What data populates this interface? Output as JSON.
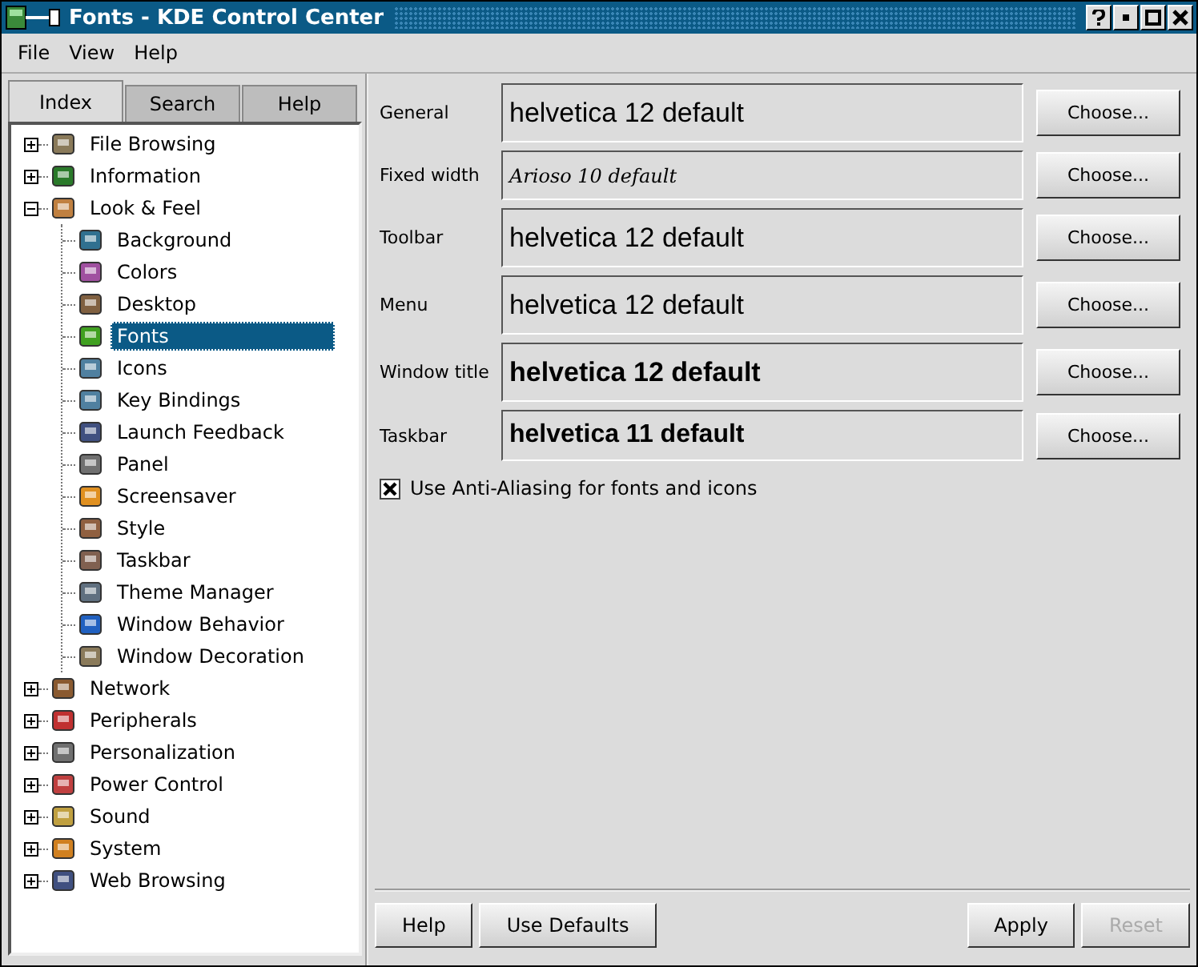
{
  "window": {
    "title": "Fonts - KDE Control Center"
  },
  "menu": [
    "File",
    "View",
    "Help"
  ],
  "tabs": [
    {
      "label": "Index",
      "selected": true
    },
    {
      "label": "Search",
      "selected": false
    },
    {
      "label": "Help",
      "selected": false
    }
  ],
  "tree": [
    {
      "label": "File Browsing",
      "expanded": false,
      "selected": false
    },
    {
      "label": "Information",
      "expanded": false,
      "selected": false
    },
    {
      "label": "Look & Feel",
      "expanded": true,
      "selected": false,
      "children": [
        {
          "label": "Background",
          "selected": false
        },
        {
          "label": "Colors",
          "selected": false
        },
        {
          "label": "Desktop",
          "selected": false
        },
        {
          "label": "Fonts",
          "selected": true
        },
        {
          "label": "Icons",
          "selected": false
        },
        {
          "label": "Key Bindings",
          "selected": false
        },
        {
          "label": "Launch Feedback",
          "selected": false
        },
        {
          "label": "Panel",
          "selected": false
        },
        {
          "label": "Screensaver",
          "selected": false
        },
        {
          "label": "Style",
          "selected": false
        },
        {
          "label": "Taskbar",
          "selected": false
        },
        {
          "label": "Theme Manager",
          "selected": false
        },
        {
          "label": "Window Behavior",
          "selected": false
        },
        {
          "label": "Window Decoration",
          "selected": false
        }
      ]
    },
    {
      "label": "Network",
      "expanded": false,
      "selected": false
    },
    {
      "label": "Peripherals",
      "expanded": false,
      "selected": false
    },
    {
      "label": "Personalization",
      "expanded": false,
      "selected": false
    },
    {
      "label": "Power Control",
      "expanded": false,
      "selected": false
    },
    {
      "label": "Sound",
      "expanded": false,
      "selected": false
    },
    {
      "label": "System",
      "expanded": false,
      "selected": false
    },
    {
      "label": "Web Browsing",
      "expanded": false,
      "selected": false
    }
  ],
  "fonts": [
    {
      "label": "General",
      "preview": "helvetica 12 default",
      "kind": "large",
      "button": "Choose..."
    },
    {
      "label": "Fixed width",
      "preview": "Arioso 10 default",
      "kind": "script",
      "button": "Choose..."
    },
    {
      "label": "Toolbar",
      "preview": "helvetica 12 default",
      "kind": "large",
      "button": "Choose..."
    },
    {
      "label": "Menu",
      "preview": "helvetica 12 default",
      "kind": "large",
      "button": "Choose..."
    },
    {
      "label": "Window title",
      "preview": "helvetica 12 default",
      "kind": "bold",
      "button": "Choose..."
    },
    {
      "label": "Taskbar",
      "preview": "helvetica 11 default",
      "kind": "medium",
      "button": "Choose..."
    }
  ],
  "antialias": {
    "label": "Use Anti-Aliasing for fonts and icons",
    "checked": true
  },
  "buttons_left": [
    {
      "label": "Help",
      "disabled": false
    },
    {
      "label": "Use Defaults",
      "disabled": false
    }
  ],
  "buttons_right": [
    {
      "label": "Apply",
      "disabled": false
    },
    {
      "label": "Reset",
      "disabled": true
    }
  ]
}
